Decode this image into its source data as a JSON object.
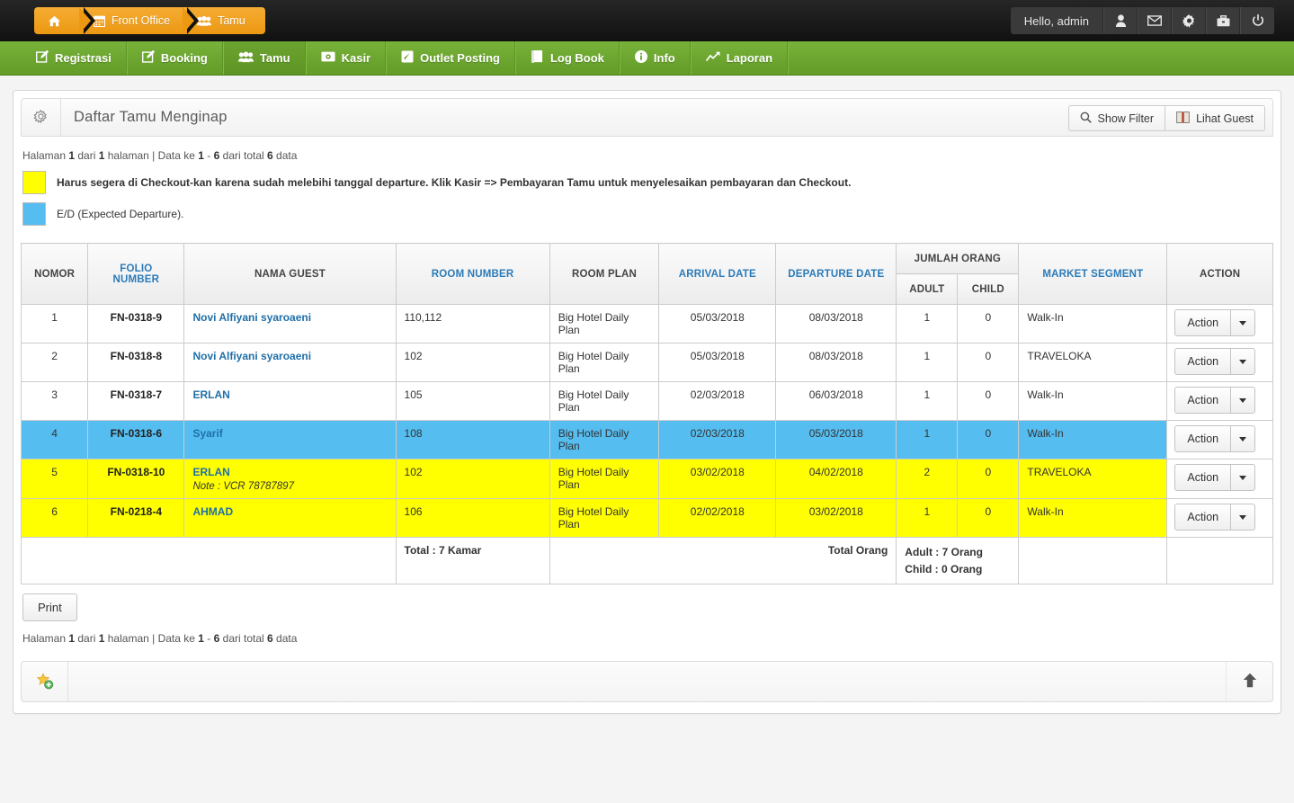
{
  "topbar": {
    "breadcrumb": [
      {
        "icon": "home-icon",
        "label": ""
      },
      {
        "icon": "calendar-icon",
        "label": "Front Office"
      },
      {
        "icon": "users-icon",
        "label": "Tamu"
      }
    ],
    "hello": "Hello, admin",
    "icons": [
      "user-icon",
      "envelope-icon",
      "gear-icon",
      "briefcase-icon",
      "power-icon"
    ]
  },
  "nav": {
    "items": [
      {
        "label": "Registrasi",
        "icon": "edit-icon"
      },
      {
        "label": "Booking",
        "icon": "edit-icon"
      },
      {
        "label": "Tamu",
        "icon": "users-icon"
      },
      {
        "label": "Kasir",
        "icon": "money-icon"
      },
      {
        "label": "Outlet Posting",
        "icon": "post-icon"
      },
      {
        "label": "Log Book",
        "icon": "book-icon"
      },
      {
        "label": "Info",
        "icon": "info-icon"
      },
      {
        "label": "Laporan",
        "icon": "chart-icon"
      }
    ],
    "active_index": 2
  },
  "panel": {
    "title": "Daftar Tamu Menginap",
    "gear_icon": "gear-icon",
    "buttons": [
      {
        "label": "Show Filter",
        "icon": "search-icon"
      },
      {
        "label": "Lihat Guest",
        "icon": "book-open-icon"
      }
    ],
    "pageinfo": {
      "prefix": "Halaman ",
      "page": "1",
      "mid1": " dari ",
      "pages": "1",
      "mid2": " halaman | Data ke ",
      "from": "1",
      "dash": " - ",
      "to": "6",
      "mid3": " dari total ",
      "total": "6",
      "suffix": " data"
    },
    "legend": [
      {
        "color": "#ffff00",
        "text": "Harus segera di Checkout-kan karena sudah melebihi tanggal departure. Klik Kasir => Pembayaran Tamu untuk menyelesaikan pembayaran dan Checkout.",
        "bold": true
      },
      {
        "color": "#55bdf0",
        "text": "E/D (Expected Departure).",
        "bold": false
      }
    ],
    "print_label": "Print"
  },
  "table": {
    "headers": {
      "nomor": "NOMOR",
      "folio": "FOLIO NUMBER",
      "nama": "NAMA GUEST",
      "room_number": "ROOM NUMBER",
      "room_plan": "ROOM PLAN",
      "arrival": "ARRIVAL DATE",
      "departure": "DEPARTURE DATE",
      "jumlah": "JUMLAH ORANG",
      "adult": "ADULT",
      "child": "CHILD",
      "market": "MARKET SEGMENT",
      "action": "ACTION"
    },
    "rows": [
      {
        "nomor": "1",
        "folio": "FN-0318-9",
        "nama": "Novi Alfiyani syaroaeni",
        "note": "",
        "room_number": "110,112",
        "room_plan": "Big Hotel Daily Plan",
        "arrival": "05/03/2018",
        "departure": "08/03/2018",
        "adult": "1",
        "child": "0",
        "market": "Walk-In",
        "action": "Action",
        "highlight": ""
      },
      {
        "nomor": "2",
        "folio": "FN-0318-8",
        "nama": "Novi Alfiyani syaroaeni",
        "note": "",
        "room_number": "102",
        "room_plan": "Big Hotel Daily Plan",
        "arrival": "05/03/2018",
        "departure": "08/03/2018",
        "adult": "1",
        "child": "0",
        "market": "TRAVELOKA",
        "action": "Action",
        "highlight": ""
      },
      {
        "nomor": "3",
        "folio": "FN-0318-7",
        "nama": "ERLAN",
        "note": "",
        "room_number": "105",
        "room_plan": "Big Hotel Daily Plan",
        "arrival": "02/03/2018",
        "departure": "06/03/2018",
        "adult": "1",
        "child": "0",
        "market": "Walk-In",
        "action": "Action",
        "highlight": ""
      },
      {
        "nomor": "4",
        "folio": "FN-0318-6",
        "nama": "Syarif",
        "note": "",
        "room_number": "108",
        "room_plan": "Big Hotel Daily Plan",
        "arrival": "02/03/2018",
        "departure": "05/03/2018",
        "adult": "1",
        "child": "0",
        "market": "Walk-In",
        "action": "Action",
        "highlight": "blue"
      },
      {
        "nomor": "5",
        "folio": "FN-0318-10",
        "nama": "ERLAN",
        "note": "Note : VCR 78787897",
        "room_number": "102",
        "room_plan": "Big Hotel Daily Plan",
        "arrival": "03/02/2018",
        "departure": "04/02/2018",
        "adult": "2",
        "child": "0",
        "market": "TRAVELOKA",
        "action": "Action",
        "highlight": "yellow"
      },
      {
        "nomor": "6",
        "folio": "FN-0218-4",
        "nama": "AHMAD",
        "note": "",
        "room_number": "106",
        "room_plan": "Big Hotel Daily Plan",
        "arrival": "02/02/2018",
        "departure": "03/02/2018",
        "adult": "1",
        "child": "0",
        "market": "Walk-In",
        "action": "Action",
        "highlight": "yellow"
      }
    ],
    "footer": {
      "total_kamar": "Total : 7 Kamar",
      "total_orang": "Total Orang",
      "adult_total": "Adult : 7 Orang",
      "child_total": "Child : 0 Orang"
    }
  },
  "bottombar": {
    "star_icon": "star-add-icon",
    "up_icon": "arrow-up-icon"
  },
  "colors": {
    "green": "#68a22d",
    "orange": "#ec9812",
    "blue_row": "#55bdf0",
    "yellow_row": "#ffff00",
    "link_blue": "#2b7bb9"
  }
}
